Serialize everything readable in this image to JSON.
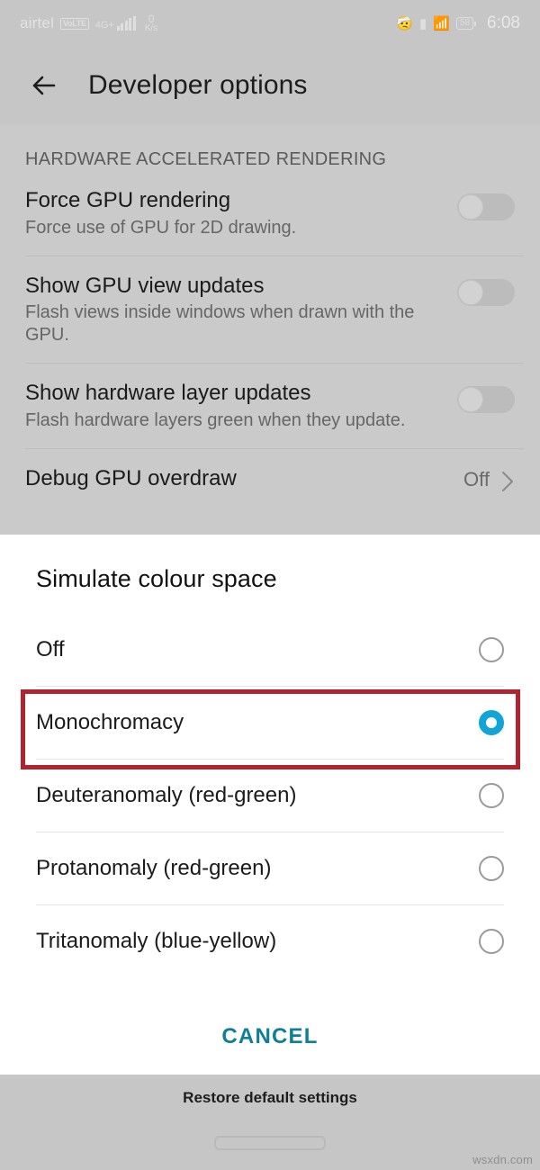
{
  "status_bar": {
    "carrier": "airtel",
    "volte_badge": "VoLTE",
    "network_type": "4G+",
    "speed_value": "0",
    "speed_unit": "K/s",
    "bluetooth_icon": "bluetooth-icon",
    "signal_icon": "signal-bars-icon",
    "sim_icon": "sim-card-icon",
    "vibrate_icon": "vibrate-icon",
    "battery_level": "58",
    "time": "6:08"
  },
  "app_bar": {
    "back_label": "back-arrow",
    "title": "Developer options"
  },
  "settings": {
    "section_title": "HARDWARE ACCELERATED RENDERING",
    "rows": [
      {
        "title": "Force GPU rendering",
        "subtitle": "Force use of GPU for 2D drawing.",
        "control": "switch",
        "state": "off"
      },
      {
        "title": "Show GPU view updates",
        "subtitle": "Flash views inside windows when drawn with the GPU.",
        "control": "switch",
        "state": "off"
      },
      {
        "title": "Show hardware layer updates",
        "subtitle": "Flash hardware layers green when they update.",
        "control": "switch",
        "state": "off"
      },
      {
        "title": "Debug GPU overdraw",
        "subtitle": "",
        "control": "value",
        "value": "Off"
      }
    ]
  },
  "dialog": {
    "title": "Simulate colour space",
    "options": [
      {
        "label": "Off",
        "selected": false
      },
      {
        "label": "Monochromacy",
        "selected": true
      },
      {
        "label": "Deuteranomaly (red-green)",
        "selected": false
      },
      {
        "label": "Protanomaly (red-green)",
        "selected": false
      },
      {
        "label": "Tritanomaly (blue-yellow)",
        "selected": false
      }
    ],
    "cancel_label": "CANCEL",
    "accent_color": "#10a5d6",
    "cancel_color": "#0e7f96",
    "highlight_color": "#b02430",
    "highlighted_option": "Monochromacy"
  },
  "footer": {
    "restore_label": "Restore default settings",
    "gesture_pill": "home-gesture-pill",
    "watermark": "wsxdn.com"
  }
}
